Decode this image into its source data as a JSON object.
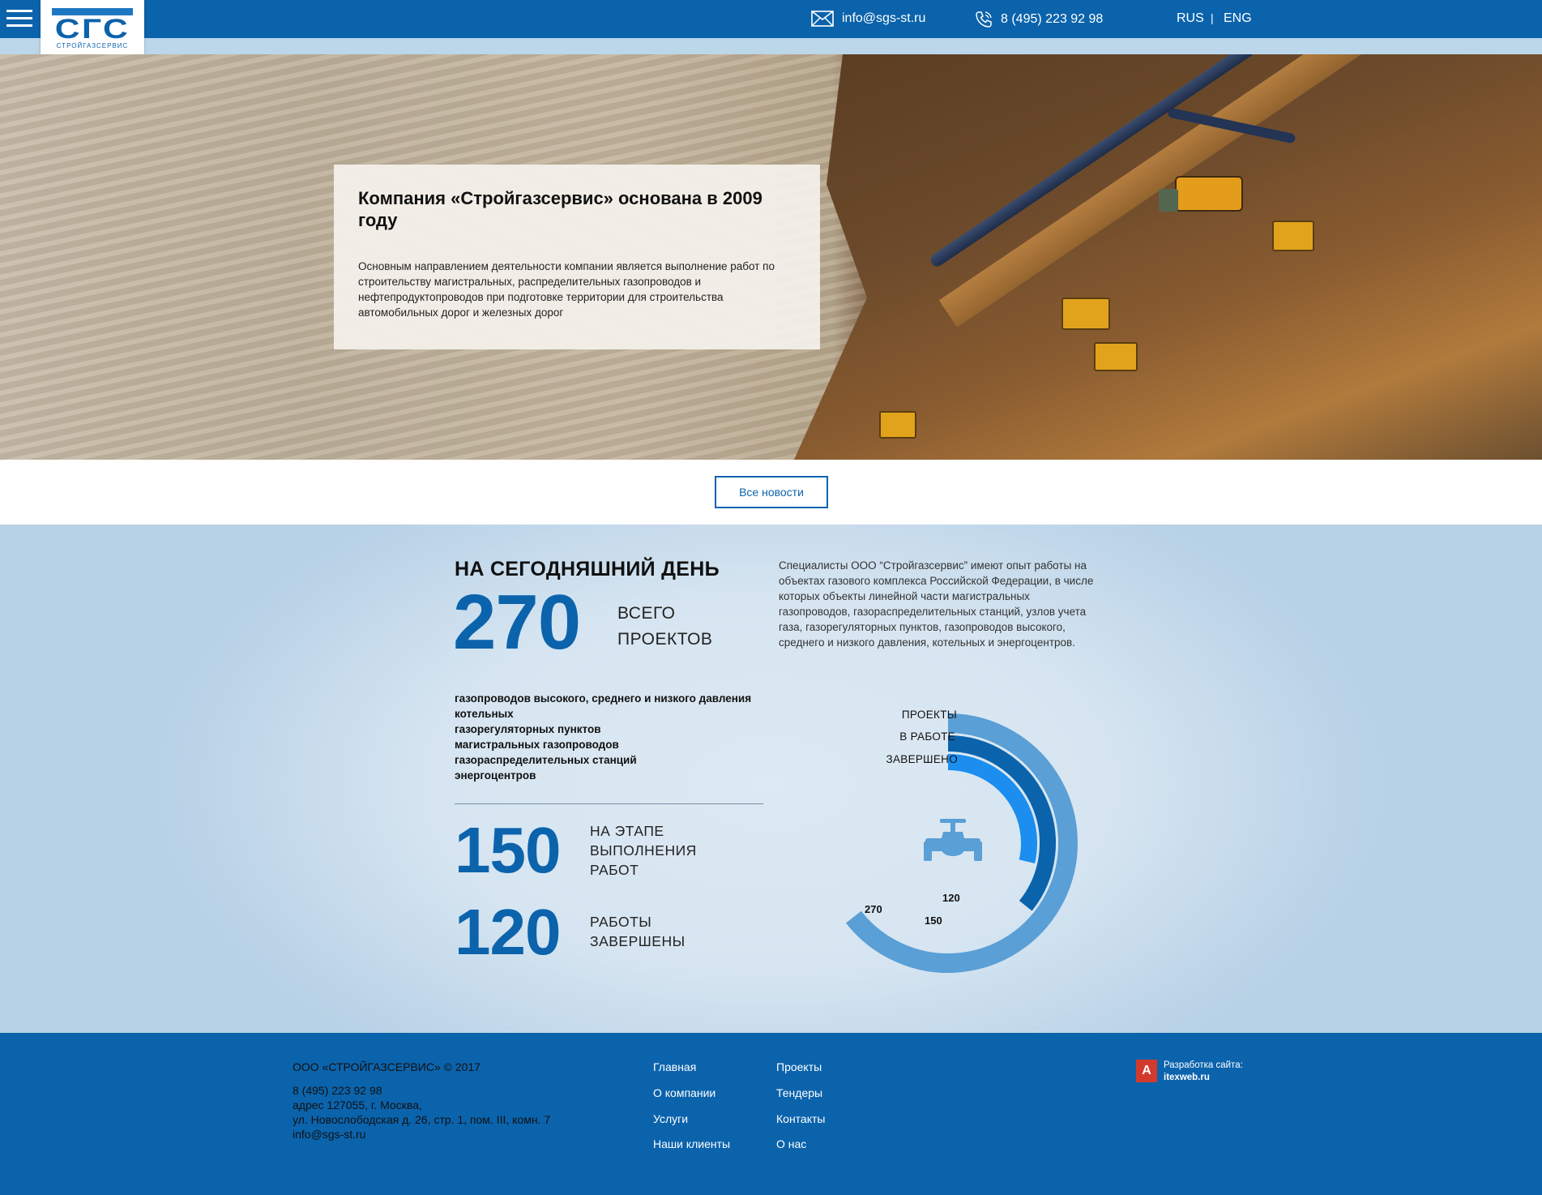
{
  "header": {
    "logo_text": "СГС",
    "logo_subtitle": "СТРОЙГАЗСЕРВИС",
    "email": "info@sgs-st.ru",
    "phone": "8 (495) 223 92 98",
    "languages": [
      "RUS",
      "ENG"
    ],
    "lang_separator": "|",
    "icons": {
      "menu": "hamburger-menu-icon",
      "email": "envelope-icon",
      "phone": "phone-icon"
    }
  },
  "hero": {
    "title": "Компания «Стройгазсервис» основана в 2009 году",
    "text": "Основным направлением деятельности компании является выполнение работ по строительству магистральных, распределительных газопроводов и нефтепродуктопроводов при подготовке территории для строительства автомобильных дорог и железных дорог"
  },
  "news_button": "Все новости",
  "stats": {
    "title": "НА СЕГОДНЯШНИЙ ДЕНЬ",
    "total": {
      "value": "270",
      "label_line1": "ВСЕГО",
      "label_line2": "ПРОЕКТОВ"
    },
    "description": "Специалисты ООО “Стройгазсервис” имеют опыт работы на объектах газового комплекса Российской Федерации, в числе которых объекты линейной части магистральных газопроводов, газораспределительных станций, узлов учета газа, газорегуляторных пунктов, газопроводов высокого, среднего и низкого давления, котельных и энергоцентров.",
    "types": [
      "газопроводов высокого, среднего и низкого давления",
      "котельных",
      "газорегуляторных пунктов",
      "магистральных газопроводов",
      "газораспределительных станций",
      "энергоцентров"
    ],
    "in_progress": {
      "value": "150",
      "label_line1": "НА ЭТАПЕ",
      "label_line2": "ВЫПОЛНЕНИЯ",
      "label_line3": "РАБОТ"
    },
    "completed": {
      "value": "120",
      "label_line1": "РАБОТЫ",
      "label_line2": "ЗАВЕРШЕНЫ"
    },
    "donut_labels": [
      "ПРОЕКТЫ",
      "В РАБОТЕ",
      "ЗАВЕРШЕНО"
    ],
    "donut_values": [
      "270",
      "150",
      "120"
    ],
    "colors": {
      "outer": "#5a9fd6",
      "middle": "#0b63ac",
      "inner": "#1b8ef0",
      "icon": "#5a9fd6"
    },
    "center_icon": "pipe-valve-icon"
  },
  "chart_data": {
    "type": "radial-bar",
    "series": [
      {
        "name": "ПРОЕКТЫ",
        "value": 270
      },
      {
        "name": "В РАБОТЕ",
        "value": 150
      },
      {
        "name": "ЗАВЕРШЕНО",
        "value": 120
      }
    ]
  },
  "footer": {
    "copyright": "ООО «СТРОЙГАЗСЕРВИС» © 2017",
    "phone": "8 (495) 223 92 98",
    "address_line1": "адрес 127055, г. Москва,",
    "address_line2": "ул. Новослободская д. 26, стр. 1, пом. III, комн. 7",
    "email": "info@sgs-st.ru",
    "nav_col1": [
      "Главная",
      "О компании",
      "Услуги",
      "Наши клиенты"
    ],
    "nav_col2": [
      "Проекты",
      "Тендеры",
      "Контакты",
      "О нас"
    ],
    "dev_label": "Разработка сайта:",
    "dev_site": "itexweb.ru",
    "dev_badge": "A"
  }
}
